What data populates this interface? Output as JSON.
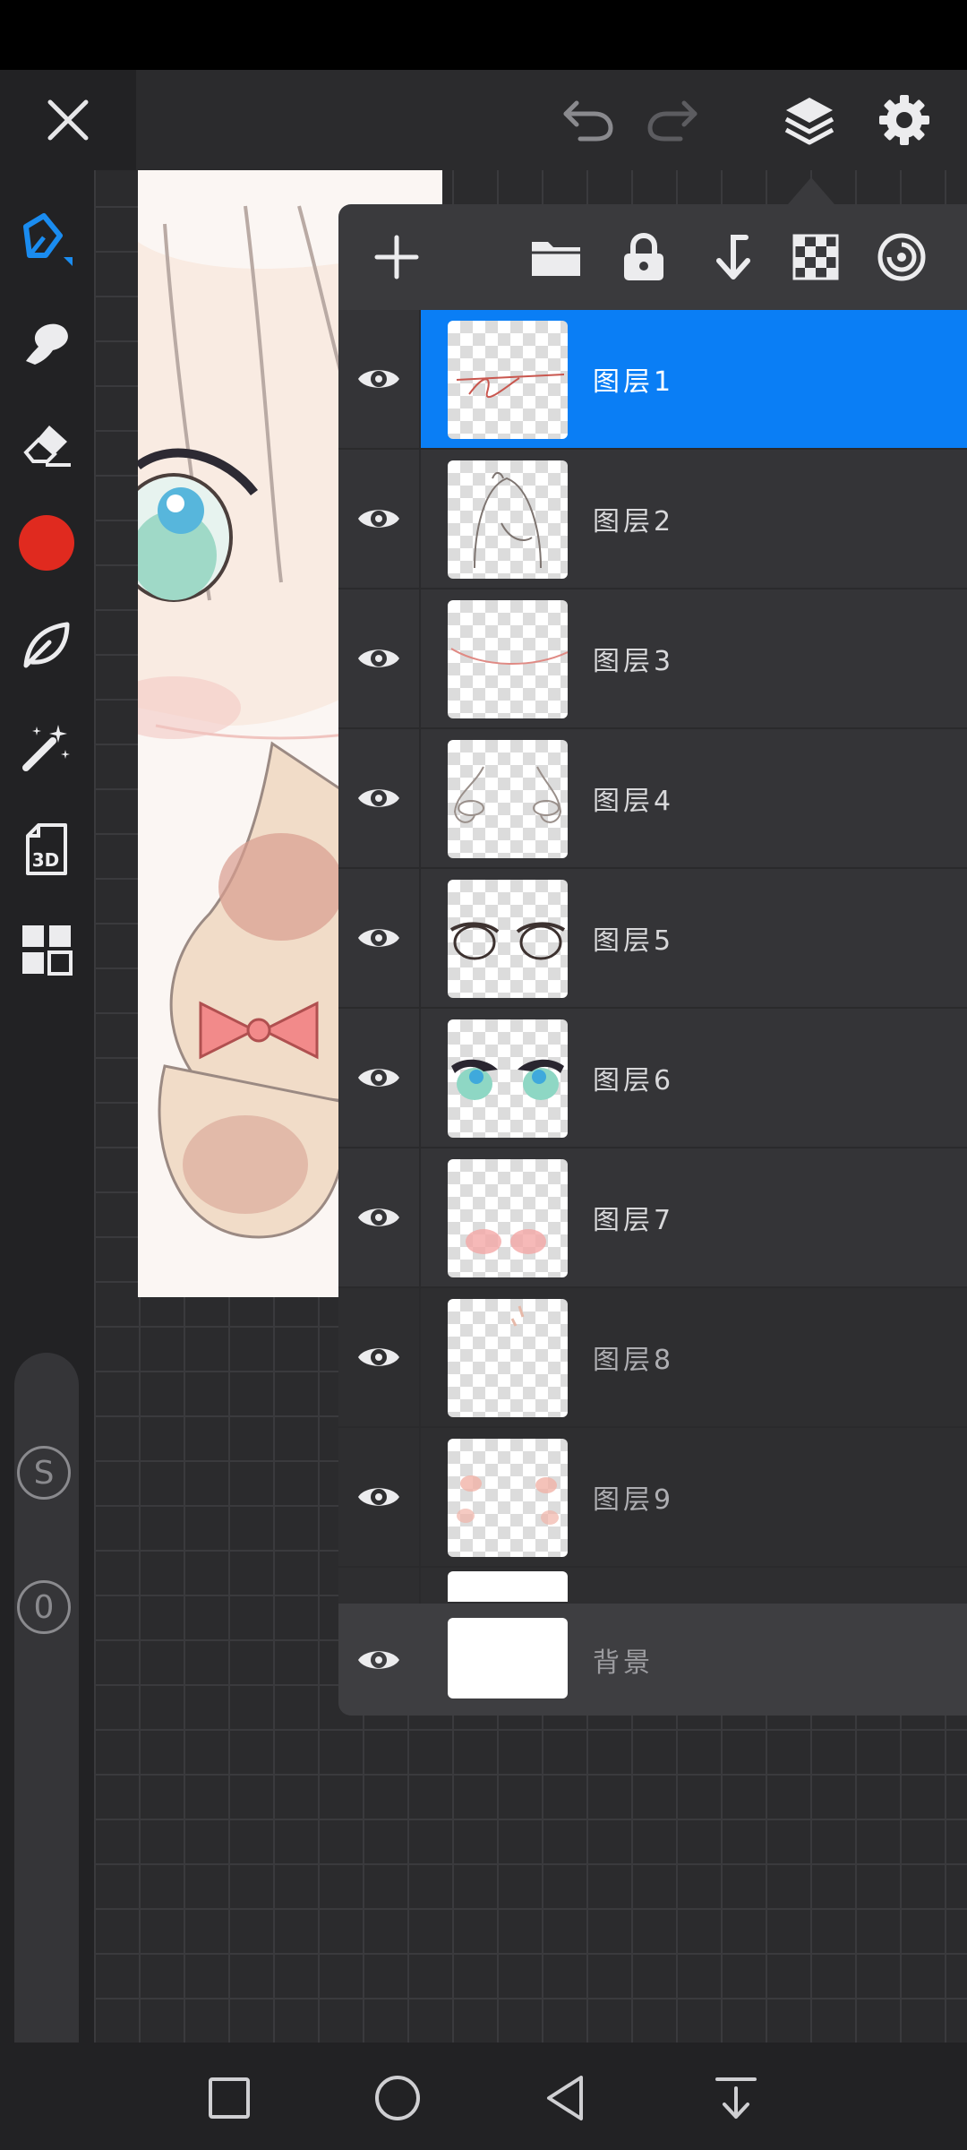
{
  "toolbar": {
    "close_icon": "close-icon",
    "undo_icon": "undo-icon",
    "redo_icon": "redo-icon",
    "layers_icon": "layers-icon",
    "settings_icon": "gear-icon"
  },
  "left_tools": [
    {
      "name": "brush-tool",
      "icon": "brush-icon",
      "active": true
    },
    {
      "name": "smudge-tool",
      "icon": "smudge-icon"
    },
    {
      "name": "eraser-tool",
      "icon": "eraser-icon"
    },
    {
      "name": "color-picker",
      "icon": "color-swatch",
      "color": "#e02a1f"
    },
    {
      "name": "brush-library",
      "icon": "leaf-icon"
    },
    {
      "name": "magic-wand-tool",
      "icon": "magic-wand-icon"
    },
    {
      "name": "3d-tool",
      "icon": "3d-file-icon",
      "label": "3D"
    },
    {
      "name": "gallery-tool",
      "icon": "grid-icon"
    }
  ],
  "brush_controls": {
    "size_label": "S",
    "opacity_label": "0"
  },
  "layers_panel": {
    "layers": [
      {
        "name": "图层1",
        "visible": true,
        "selected": true
      },
      {
        "name": "图层2",
        "visible": true
      },
      {
        "name": "图层3",
        "visible": true
      },
      {
        "name": "图层4",
        "visible": true
      },
      {
        "name": "图层5",
        "visible": true
      },
      {
        "name": "图层6",
        "visible": true
      },
      {
        "name": "图层7",
        "visible": true
      },
      {
        "name": "图层8",
        "visible": true
      },
      {
        "name": "图层9",
        "visible": true
      }
    ],
    "background": {
      "name": "背景",
      "visible": true
    }
  },
  "colors": {
    "accent": "#0a7ef5",
    "selected_brush": "#1a8cf0",
    "current_color": "#e02a1f"
  }
}
